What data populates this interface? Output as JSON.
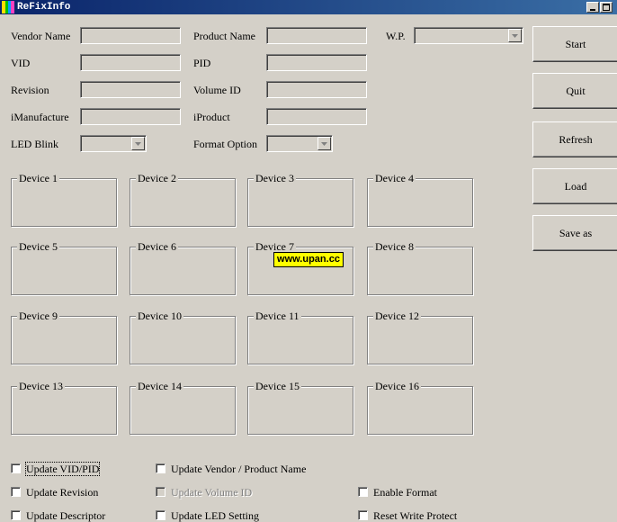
{
  "window": {
    "title": "ReFixInfo"
  },
  "fields": {
    "vendor_name": {
      "label": "Vendor Name",
      "value": ""
    },
    "product_name": {
      "label": "Product Name",
      "value": ""
    },
    "wp": {
      "label": "W.P.",
      "value": ""
    },
    "vid": {
      "label": "VID",
      "value": ""
    },
    "pid": {
      "label": "PID",
      "value": ""
    },
    "revision": {
      "label": "Revision",
      "value": ""
    },
    "volume_id": {
      "label": "Volume ID",
      "value": ""
    },
    "imanufacture": {
      "label": "iManufacture",
      "value": ""
    },
    "iproduct": {
      "label": "iProduct",
      "value": ""
    },
    "led_blink": {
      "label": "LED Blink",
      "value": ""
    },
    "format_option": {
      "label": "Format Option",
      "value": ""
    }
  },
  "devices": [
    "Device 1",
    "Device 2",
    "Device 3",
    "Device 4",
    "Device 5",
    "Device 6",
    "Device 7",
    "Device 8",
    "Device 9",
    "Device 10",
    "Device 11",
    "Device 12",
    "Device 13",
    "Device 14",
    "Device 15",
    "Device 16"
  ],
  "buttons": {
    "start": "Start",
    "quit": "Quit",
    "refresh": "Refresh",
    "load": "Load",
    "save_as": "Save as"
  },
  "checkboxes": {
    "update_vid_pid": {
      "label": "Update VID/PID",
      "checked": false
    },
    "update_vendor_product": {
      "label": "Update Vendor / Product Name",
      "checked": false
    },
    "update_revision": {
      "label": "Update Revision",
      "checked": false
    },
    "update_volume_id": {
      "label": "Update Volume ID",
      "checked": false,
      "disabled": true
    },
    "enable_format": {
      "label": "Enable Format",
      "checked": false
    },
    "update_descriptor": {
      "label": "Update Descriptor",
      "checked": false
    },
    "update_led_setting": {
      "label": "Update LED Setting",
      "checked": false
    },
    "reset_write_protect": {
      "label": "Reset Write Protect",
      "checked": false
    }
  },
  "watermark": {
    "text": "www.upan.cc"
  }
}
